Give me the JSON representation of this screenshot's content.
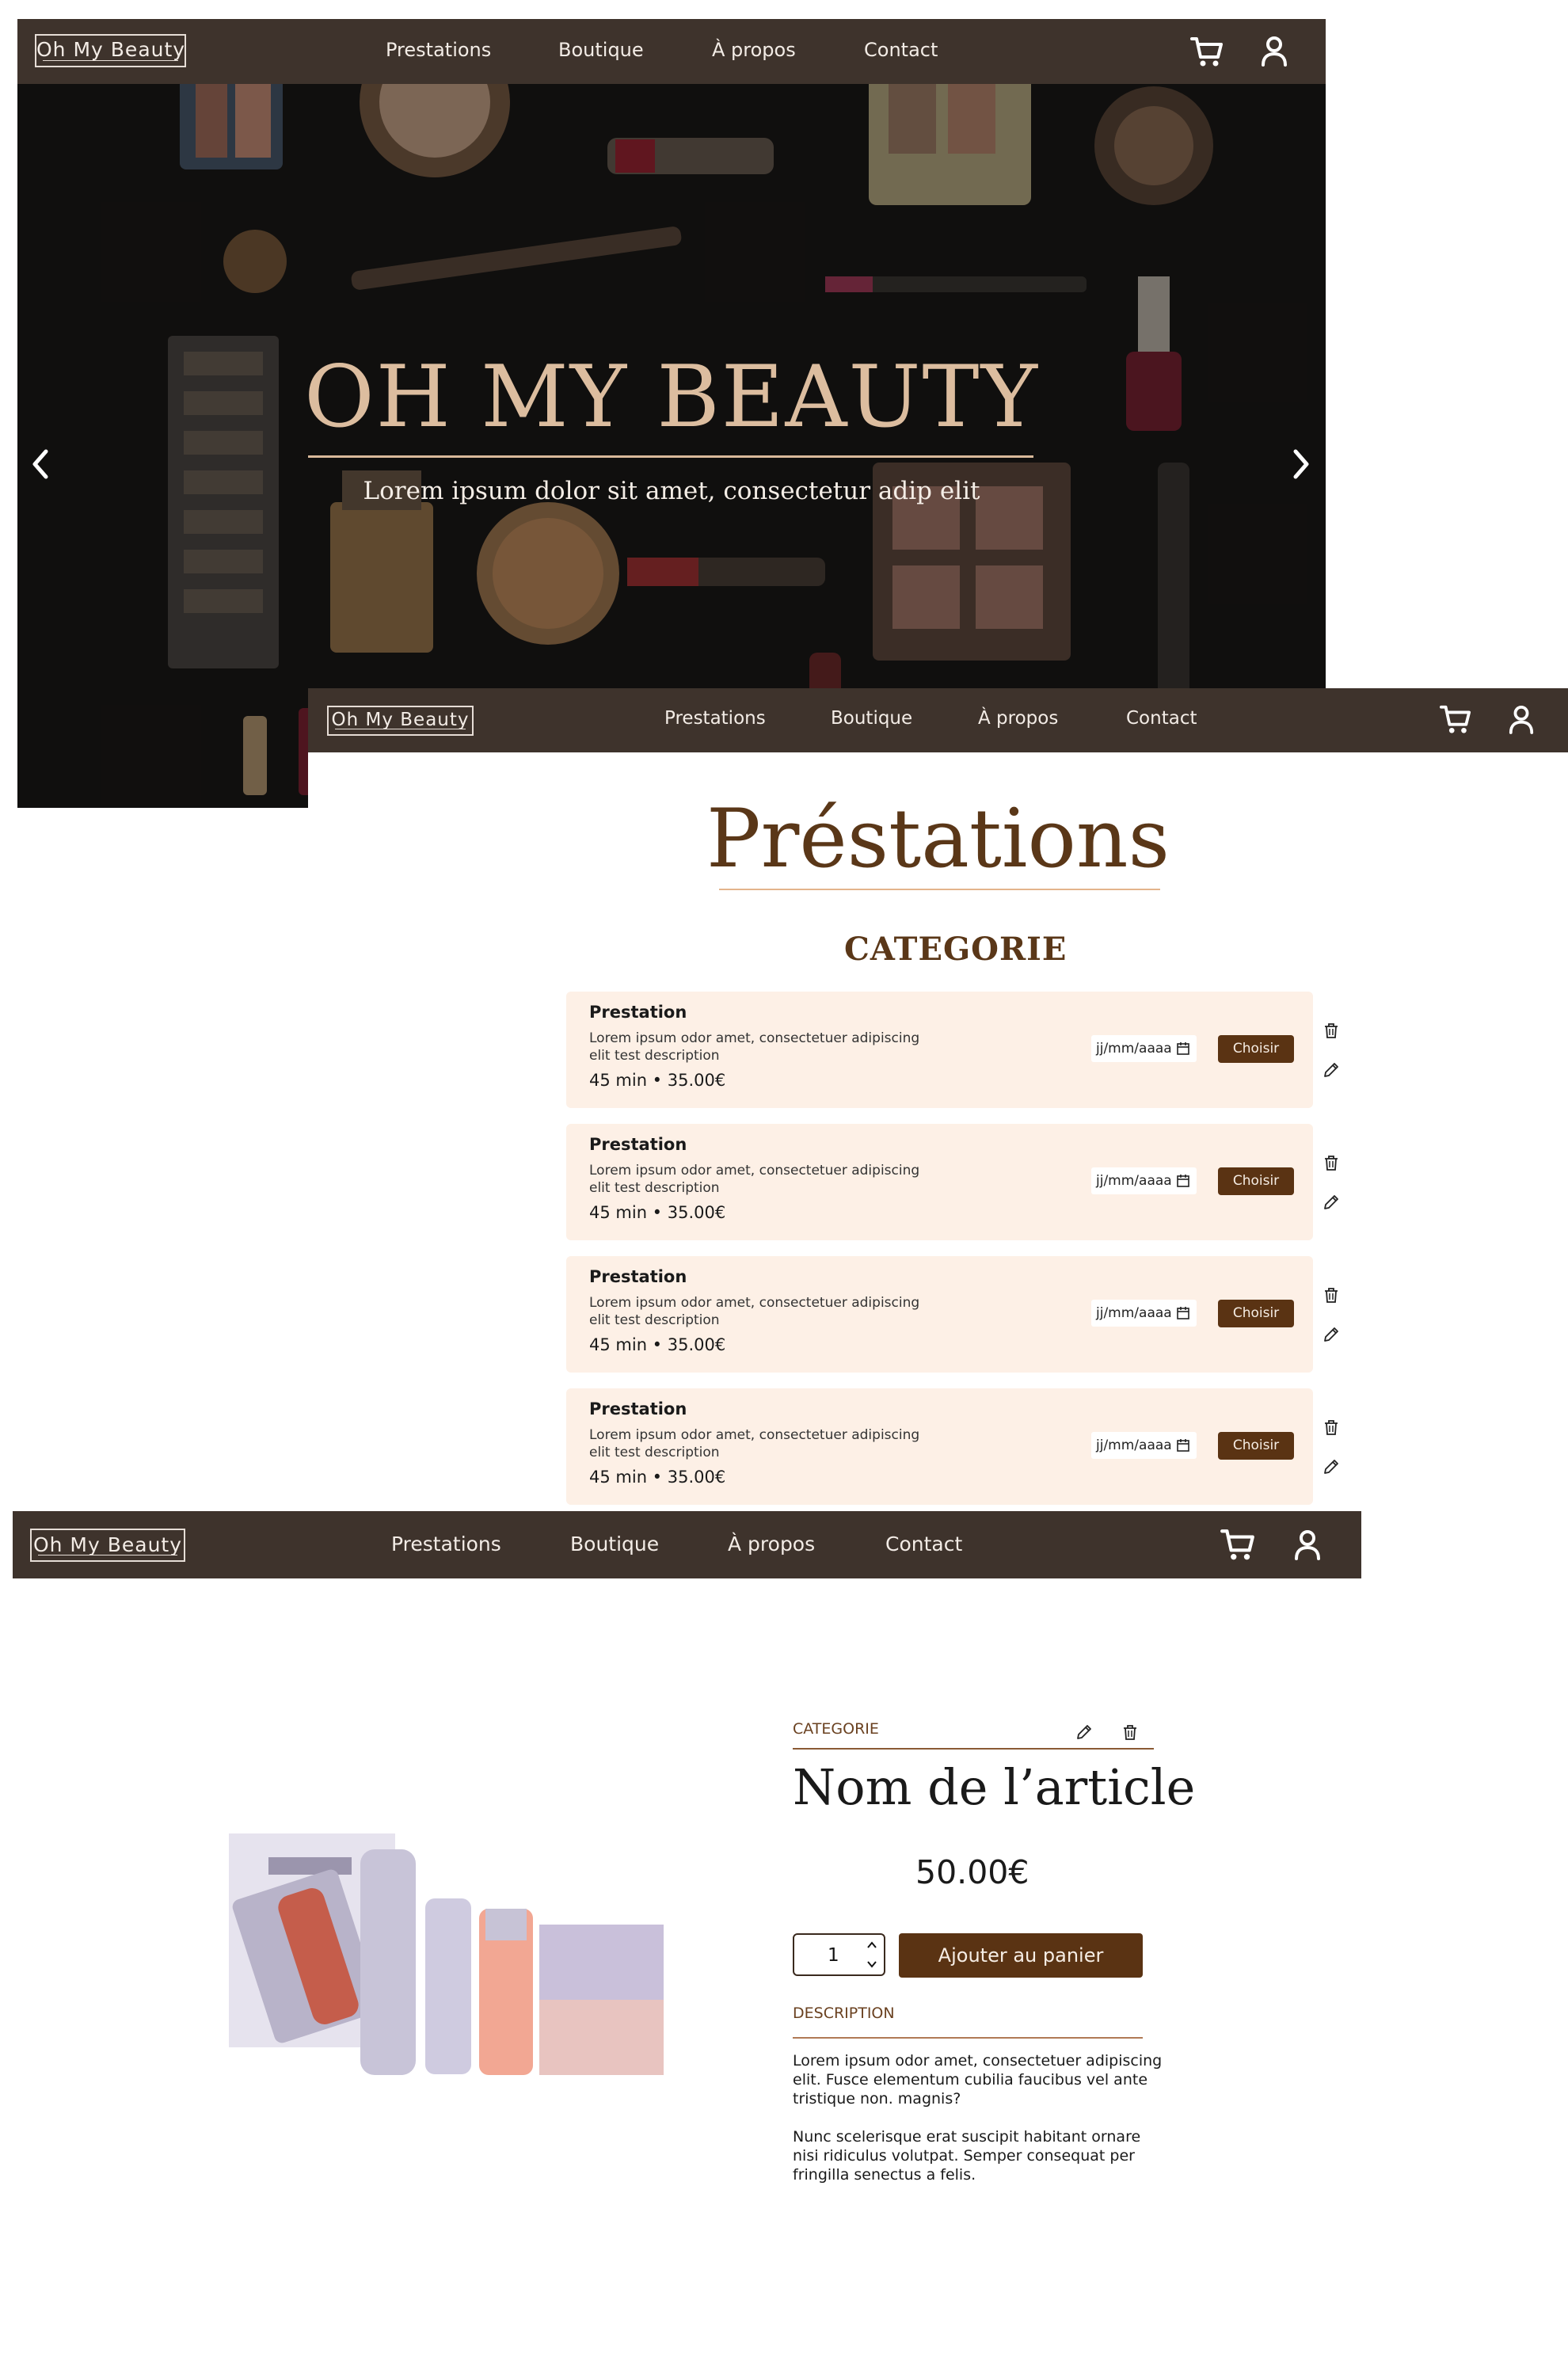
{
  "nav": {
    "logo": "Oh My Beauty",
    "links": [
      "Prestations",
      "Boutique",
      "À propos",
      "Contact"
    ],
    "cart_icon": "cart-icon",
    "user_icon": "user-icon"
  },
  "hero": {
    "title": "OH MY BEAUTY",
    "subtitle": "Lorem ipsum dolor sit amet, consectetur adip elit"
  },
  "prestations": {
    "title": "Préstations",
    "category": "CATEGORIE",
    "items": [
      {
        "name": "Prestation",
        "description": "Lorem ipsum odor amet, consectetuer adipiscing elit test description",
        "meta": "45 min • 35.00€",
        "date_placeholder": "jj/mm/aaaa",
        "button": "Choisir"
      },
      {
        "name": "Prestation",
        "description": "Lorem ipsum odor amet, consectetuer adipiscing elit test description",
        "meta": "45 min • 35.00€",
        "date_placeholder": "jj/mm/aaaa",
        "button": "Choisir"
      },
      {
        "name": "Prestation",
        "description": "Lorem ipsum odor amet, consectetuer adipiscing elit test description",
        "meta": "45 min • 35.00€",
        "date_placeholder": "jj/mm/aaaa",
        "button": "Choisir"
      },
      {
        "name": "Prestation",
        "description": "Lorem ipsum odor amet, consectetuer adipiscing elit test description",
        "meta": "45 min • 35.00€",
        "date_placeholder": "jj/mm/aaaa",
        "button": "Choisir"
      }
    ]
  },
  "product": {
    "category": "CATEGORIE",
    "name": "Nom de l’article",
    "price": "50.00€",
    "quantity": "1",
    "add_to_cart": "Ajouter au panier",
    "description_title": "DESCRIPTION",
    "description_p1": "Lorem ipsum odor amet, consectetuer adipiscing elit. Fusce elementum cubilia faucibus vel ante tristique non.  magnis?",
    "description_p2": "Nunc scelerisque erat suscipit habitant ornare nisi ridiculus volutpat. Semper consequat per fringilla senectus a felis."
  },
  "colors": {
    "nav_bg": "#3e332c",
    "accent_brown": "#5a3313",
    "card_bg": "#fdf0e6",
    "hero_title": "#dcbd9f"
  }
}
